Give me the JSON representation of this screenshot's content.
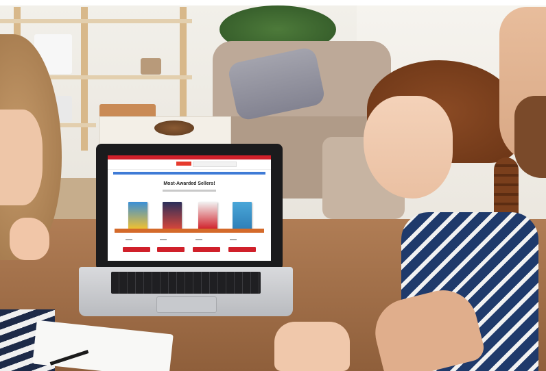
{
  "scene": {
    "description_free": true
  },
  "laptop_screen": {
    "site_heading": "Most-Awarded Sellers!",
    "book_colors": [
      "#3a8fd6",
      "#2a2f5a",
      "#f2f2f2",
      "#4aa7d8"
    ],
    "brand_color": "#d0202a",
    "nav_color": "#3f7bd6"
  }
}
